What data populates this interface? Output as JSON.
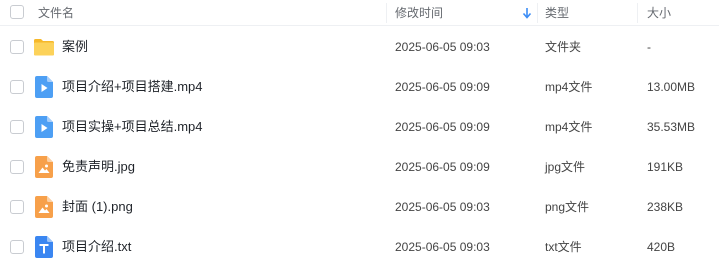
{
  "header": {
    "name_label": "文件名",
    "modified_label": "修改时间",
    "type_label": "类型",
    "size_label": "大小"
  },
  "colors": {
    "folder": "#f8c33a",
    "video": "#4d9ff4",
    "image": "#f7a04a",
    "text": "#3a86f1",
    "sort_arrow": "#3b8cf5"
  },
  "rows": [
    {
      "icon": "folder-icon",
      "name": "案例",
      "modified": "2025-06-05 09:03",
      "type": "文件夹",
      "size": "-"
    },
    {
      "icon": "video-file-icon",
      "name": "项目介绍+项目搭建.mp4",
      "modified": "2025-06-05 09:09",
      "type": "mp4文件",
      "size": "13.00MB"
    },
    {
      "icon": "video-file-icon",
      "name": "项目实操+项目总结.mp4",
      "modified": "2025-06-05 09:09",
      "type": "mp4文件",
      "size": "35.53MB"
    },
    {
      "icon": "image-file-icon",
      "name": "免责声明.jpg",
      "modified": "2025-06-05 09:09",
      "type": "jpg文件",
      "size": "191KB"
    },
    {
      "icon": "image-file-icon",
      "name": "封面 (1).png",
      "modified": "2025-06-05 09:03",
      "type": "png文件",
      "size": "238KB"
    },
    {
      "icon": "text-file-icon",
      "name": "项目介绍.txt",
      "modified": "2025-06-05 09:03",
      "type": "txt文件",
      "size": "420B"
    }
  ]
}
